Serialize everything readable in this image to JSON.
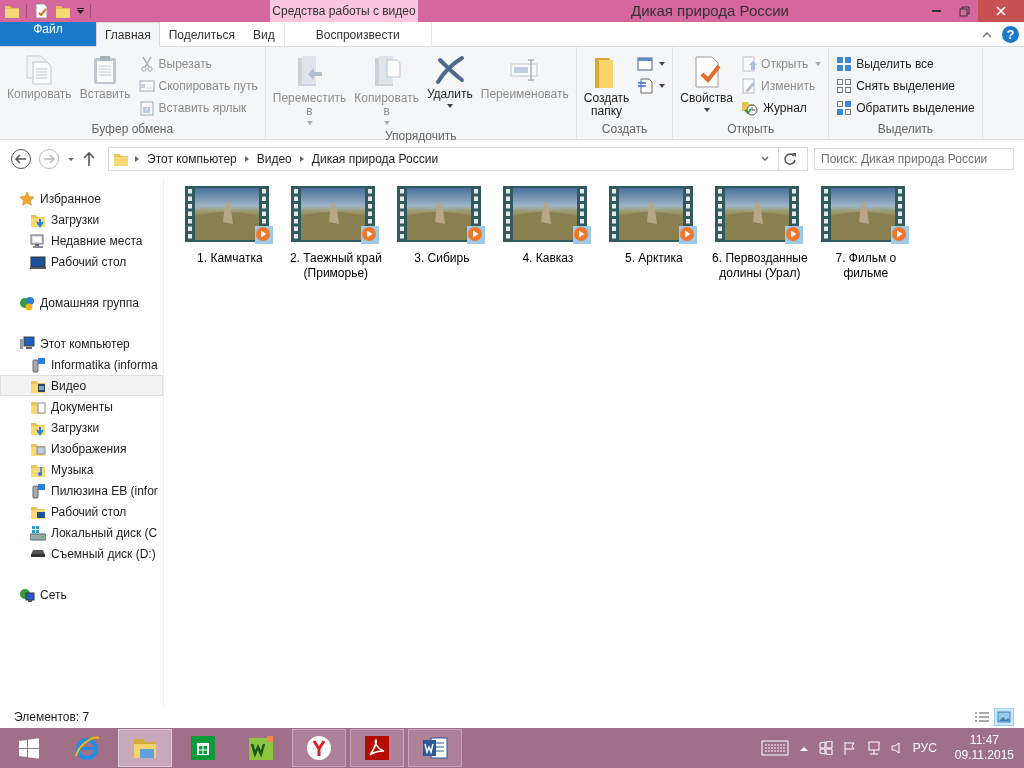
{
  "window": {
    "title": "Дикая природа России",
    "context_group": "Средства работы с видео",
    "help": "?"
  },
  "ribbon": {
    "tabs": [
      {
        "label": "Файл",
        "kind": "file",
        "selected": false
      },
      {
        "label": "Главная",
        "kind": "normal",
        "selected": true
      },
      {
        "label": "Поделиться",
        "kind": "normal",
        "selected": false
      },
      {
        "label": "Вид",
        "kind": "normal",
        "selected": false
      },
      {
        "label": "Воспроизвести",
        "kind": "context",
        "selected": false
      }
    ],
    "groups": [
      {
        "title": "Буфер обмена",
        "commands": [
          {
            "kind": "large",
            "label": "Копировать",
            "disabled": true,
            "dropdown": false
          },
          {
            "kind": "large",
            "label": "Вставить",
            "disabled": true,
            "dropdown": false
          },
          {
            "kind": "small",
            "label": "Вырезать",
            "disabled": true,
            "dropdown": false
          },
          {
            "kind": "small",
            "label": "Скопировать путь",
            "disabled": true,
            "dropdown": false
          },
          {
            "kind": "small",
            "label": "Вставить ярлык",
            "disabled": true,
            "dropdown": false
          }
        ]
      },
      {
        "title": "Упорядочить",
        "commands": [
          {
            "kind": "large",
            "label": "Переместить в",
            "disabled": true,
            "dropdown": true
          },
          {
            "kind": "large",
            "label": "Копировать в",
            "disabled": true,
            "dropdown": true
          },
          {
            "kind": "large",
            "label": "Удалить",
            "disabled": false,
            "dropdown": true
          },
          {
            "kind": "large",
            "label": "Переименовать",
            "disabled": true,
            "dropdown": false
          }
        ]
      },
      {
        "title": "Создать",
        "commands": [
          {
            "kind": "large",
            "label": "Создать папку",
            "disabled": false,
            "dropdown": false
          },
          {
            "kind": "icon",
            "disabled": false,
            "dropdown": true
          },
          {
            "kind": "icon",
            "disabled": false,
            "dropdown": true
          }
        ]
      },
      {
        "title": "Открыть",
        "commands": [
          {
            "kind": "large",
            "label": "Свойства",
            "disabled": false,
            "dropdown": true
          },
          {
            "kind": "small",
            "label": "Открыть",
            "disabled": true,
            "dropdown": true
          },
          {
            "kind": "small",
            "label": "Изменить",
            "disabled": true,
            "dropdown": false
          },
          {
            "kind": "small",
            "label": "Журнал",
            "disabled": false,
            "dropdown": false
          }
        ]
      },
      {
        "title": "Выделить",
        "commands": [
          {
            "kind": "small",
            "label": "Выделить все",
            "disabled": false,
            "dropdown": false
          },
          {
            "kind": "small",
            "label": "Снять выделение",
            "disabled": false,
            "dropdown": false
          },
          {
            "kind": "small",
            "label": "Обратить выделение",
            "disabled": false,
            "dropdown": false
          }
        ]
      }
    ]
  },
  "address": {
    "path": [
      "Этот компьютер",
      "Видео",
      "Дикая природа России"
    ],
    "search_placeholder": "Поиск: Дикая природа России"
  },
  "navigation": [
    {
      "kind": "favorites",
      "label": "Избранное",
      "selected": false,
      "children": [
        {
          "kind": "downloads",
          "label": "Загрузки",
          "selected": false
        },
        {
          "kind": "recent",
          "label": "Недавние места",
          "selected": false
        },
        {
          "kind": "desktop",
          "label": "Рабочий стол",
          "selected": false
        }
      ]
    },
    {
      "kind": "homegroup",
      "label": "Домашняя группа",
      "selected": false
    },
    {
      "kind": "computer",
      "label": "Этот компьютер",
      "selected": false,
      "children": [
        {
          "kind": "netdrive",
          "label": "Informatika (informa",
          "selected": false
        },
        {
          "kind": "videos",
          "label": "Видео",
          "selected": true
        },
        {
          "kind": "documents",
          "label": "Документы",
          "selected": false
        },
        {
          "kind": "downloads",
          "label": "Загрузки",
          "selected": false
        },
        {
          "kind": "pictures",
          "label": "Изображения",
          "selected": false
        },
        {
          "kind": "music",
          "label": "Музыка",
          "selected": false
        },
        {
          "kind": "netdrive",
          "label": "Пилюзина ЕВ (infor",
          "selected": false
        },
        {
          "kind": "desktopfolder",
          "label": "Рабочий стол",
          "selected": false
        },
        {
          "kind": "localdisk",
          "label": "Локальный диск (С",
          "selected": false
        },
        {
          "kind": "removable",
          "label": "Съемный диск (D:)",
          "selected": false
        }
      ]
    },
    {
      "kind": "network",
      "label": "Сеть",
      "selected": false
    }
  ],
  "files": [
    {
      "name": "1. Камчатка"
    },
    {
      "name": "2. Таежный край (Приморье)"
    },
    {
      "name": "3. Сибирь"
    },
    {
      "name": "4. Кавказ"
    },
    {
      "name": "5. Арктика"
    },
    {
      "name": "6. Первозданные долины (Урал)"
    },
    {
      "name": "7. Фильм о фильме"
    }
  ],
  "status_bar": {
    "item_count": "Элементов: 7",
    "views": [
      {
        "kind": "details",
        "selected": false
      },
      {
        "kind": "large_icons",
        "selected": true
      }
    ]
  },
  "taskbar": {
    "apps": [
      {
        "kind": "start",
        "selected": false,
        "running": false
      },
      {
        "kind": "ie",
        "selected": false,
        "running": false
      },
      {
        "kind": "explorer",
        "selected": true,
        "running": true
      },
      {
        "kind": "store",
        "selected": false,
        "running": false
      },
      {
        "kind": "ws",
        "selected": false,
        "running": false
      },
      {
        "kind": "yandex",
        "selected": false,
        "running": true
      },
      {
        "kind": "acrobat",
        "selected": false,
        "running": true
      },
      {
        "kind": "word",
        "selected": false,
        "running": true
      }
    ],
    "language": "РУС",
    "time": "11:47",
    "date": "09.11.2015"
  }
}
